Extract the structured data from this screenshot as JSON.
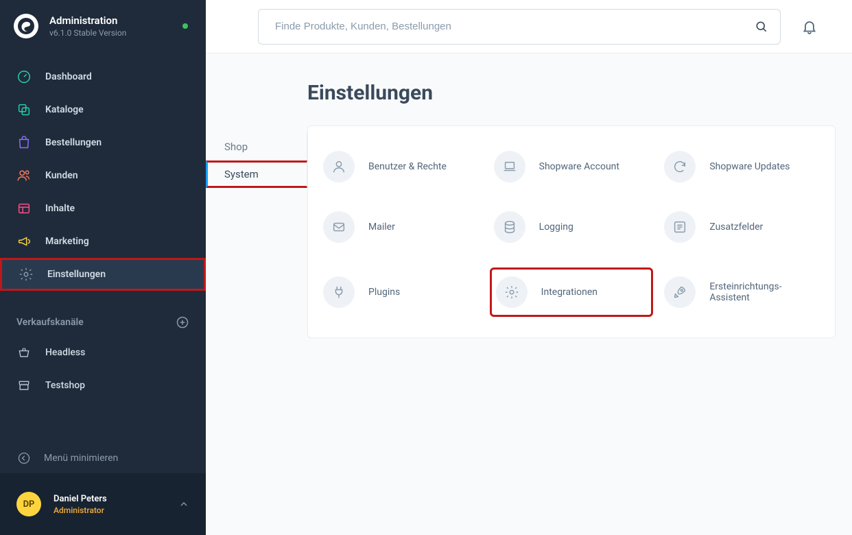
{
  "app": {
    "title": "Administration",
    "version": "v6.1.0 Stable Version"
  },
  "sidebar": {
    "items": [
      {
        "label": "Dashboard",
        "icon": "gauge",
        "color": "#3dd598"
      },
      {
        "label": "Kataloge",
        "icon": "stack",
        "color": "#3dd598"
      },
      {
        "label": "Bestellungen",
        "icon": "shopping-bag",
        "color": "#8e6cff"
      },
      {
        "label": "Kunden",
        "icon": "users",
        "color": "#ff7a59"
      },
      {
        "label": "Inhalte",
        "icon": "content",
        "color": "#ff4d8d"
      },
      {
        "label": "Marketing",
        "icon": "megaphone",
        "color": "#ffd53f"
      },
      {
        "label": "Einstellungen",
        "icon": "gear",
        "color": "#8b9bab",
        "active": true,
        "highlighted": true
      }
    ],
    "channels_heading": "Verkaufskanäle",
    "channels": [
      {
        "label": "Headless",
        "icon": "basket"
      },
      {
        "label": "Testshop",
        "icon": "storefront"
      }
    ],
    "collapse_label": "Menü minimieren"
  },
  "user": {
    "initials": "DP",
    "name": "Daniel Peters",
    "role": "Administrator"
  },
  "search": {
    "placeholder": "Finde Produkte, Kunden, Bestellungen"
  },
  "page": {
    "title": "Einstellungen",
    "tabs": [
      {
        "label": "Shop",
        "active": false
      },
      {
        "label": "System",
        "active": true,
        "highlighted": true
      }
    ],
    "settings": [
      {
        "label": "Benutzer & Rechte",
        "icon": "user"
      },
      {
        "label": "Shopware Account",
        "icon": "laptop"
      },
      {
        "label": "Shopware Updates",
        "icon": "refresh"
      },
      {
        "label": "Mailer",
        "icon": "mail"
      },
      {
        "label": "Logging",
        "icon": "database"
      },
      {
        "label": "Zusatzfelder",
        "icon": "list"
      },
      {
        "label": "Plugins",
        "icon": "plug"
      },
      {
        "label": "Integrationen",
        "icon": "gear",
        "highlighted": true
      },
      {
        "label": "Ersteinrichtungs-Assistent",
        "icon": "rocket"
      }
    ]
  }
}
